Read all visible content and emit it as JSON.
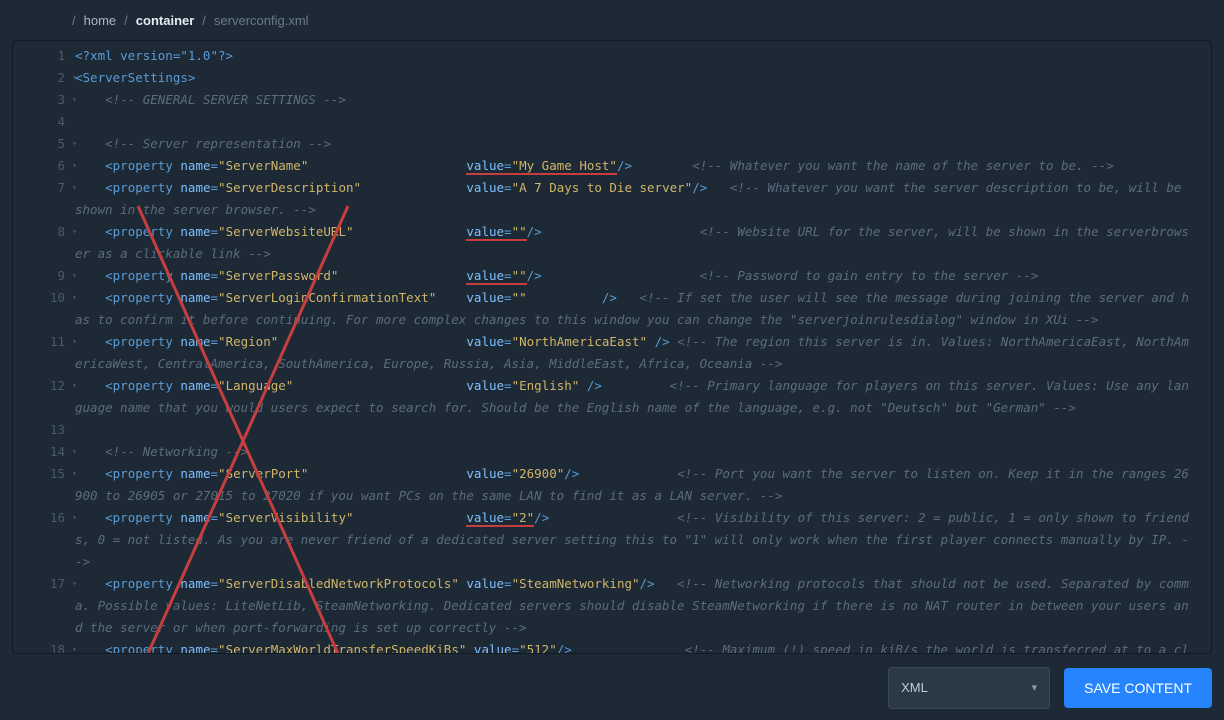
{
  "breadcrumb": {
    "home": "home",
    "container": "container",
    "file": "serverconfig.xml"
  },
  "lines": {
    "l1": "<?xml version=\"1.0\"?>",
    "l2": "<ServerSettings>",
    "l3": "<!-- GENERAL SERVER SETTINGS -->",
    "l5": "<!-- Server representation -->",
    "l6c": "<!-- Whatever you want the name of the server to be. -->",
    "l7c": "<!-- Whatever you want the server description to be, will be shown in the server browser. -->",
    "l8c": "<!-- Website URL for the server, will be shown in the serverbrowser as a clickable link -->",
    "l9c": "<!-- Password to gain entry to the server -->",
    "l10c": "<!-- If set the user will see the message during joining the server and has to confirm it before continuing. For more complex changes to this window you can change the \"serverjoinrulesdialog\" window in XUi -->",
    "l11c": "<!-- The region this server is in. Values: NorthAmericaEast, NorthAmericaWest, CentralAmerica, SouthAmerica, Europe, Russia, Asia, MiddleEast, Africa, Oceania -->",
    "l12c": "<!-- Primary language for players on this server. Values: Use any language name that you would users expect to search for. Should be the English name of the language, e.g. not \"Deutsch\" but \"German\" -->",
    "l14": "<!-- Networking -->",
    "l15c": "<!-- Port you want the server to listen on. Keep it in the ranges 26900 to 26905 or 27015 to 27020 if you want PCs on the same LAN to find it as a LAN server. -->",
    "l16c": "<!-- Visibility of this server: 2 = public, 1 = only shown to friends, 0 = not listed. As you are never friend of a dedicated server setting this to \"1\" will only work when the first player connects manually by IP. -->",
    "l17c": "<!-- Networking protocols that should not be used. Separated by comma. Possible values: LiteNetLib, SteamNetworking. Dedicated servers should disable SteamNetworking if there is no NAT router in between your users and the server or when port-forwarding is set up correctly -->",
    "l18c": "<!-- Maximum (!) speed in kiB/s the world is transferred at to a client on"
  },
  "props": {
    "p6": {
      "name": "ServerName",
      "valpad": "                     ",
      "val": "My Game Host",
      "u": true
    },
    "p7": {
      "name": "ServerDescription",
      "valpad": "              ",
      "val": "A 7 Days to Die server"
    },
    "p8": {
      "name": "ServerWebsiteURL",
      "valpad": "               ",
      "val": "",
      "u": true
    },
    "p9": {
      "name": "ServerPassword",
      "valpad": "                 ",
      "val": "",
      "u": true
    },
    "p10": {
      "name": "ServerLoginConfirmationText",
      "valpad": "    ",
      "val": ""
    },
    "p11": {
      "name": "Region",
      "valpad": "                         ",
      "val": "NorthAmericaEast",
      "sp": " "
    },
    "p12": {
      "name": "Language",
      "valpad": "                       ",
      "val": "English",
      "sp": " "
    },
    "p15": {
      "name": "ServerPort",
      "valpad": "                     ",
      "val": "26900"
    },
    "p16": {
      "name": "ServerVisibility",
      "valpad": "               ",
      "val": "2",
      "u": true
    },
    "p17": {
      "name": "ServerDisabledNetworkProtocols",
      "valpad": " ",
      "val": "SteamNetworking"
    },
    "p18": {
      "name": "ServerMaxWorldTransferSpeedKiBs",
      "valpad": " ",
      "val": "512"
    }
  },
  "footer": {
    "format": "XML",
    "save": "SAVE CONTENT"
  }
}
